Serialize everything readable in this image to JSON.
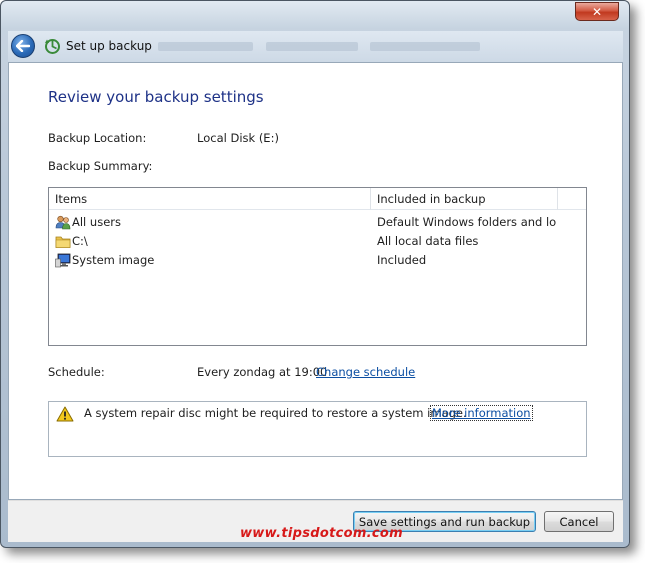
{
  "window": {
    "title": "Set up backup",
    "close_glyph": "✕"
  },
  "page": {
    "heading": "Review your backup settings",
    "backup_location_label": "Backup Location:",
    "backup_location_value": "Local Disk (E:)",
    "backup_summary_label": "Backup Summary:"
  },
  "summary_table": {
    "columns": [
      "Items",
      "Included in backup"
    ],
    "rows": [
      {
        "item": "All users",
        "icon": "users-icon",
        "included": "Default Windows folders and lo..."
      },
      {
        "item": "C:\\",
        "icon": "folder-icon",
        "included": "All local data files"
      },
      {
        "item": "System image",
        "icon": "system-image-icon",
        "included": "Included"
      }
    ]
  },
  "schedule": {
    "label": "Schedule:",
    "value": "Every zondag at 19:00",
    "change_link": "Change schedule"
  },
  "info": {
    "icon": "warning-icon",
    "text": "A system repair disc might be required to restore a system image.",
    "link": "More information"
  },
  "footer": {
    "primary_button": "Save settings and run backup",
    "cancel_button": "Cancel"
  },
  "watermark": "www.tipsdotcom.com",
  "colors": {
    "heading": "#1e3287",
    "link": "#0b4ea2",
    "watermark": "#d71919"
  }
}
